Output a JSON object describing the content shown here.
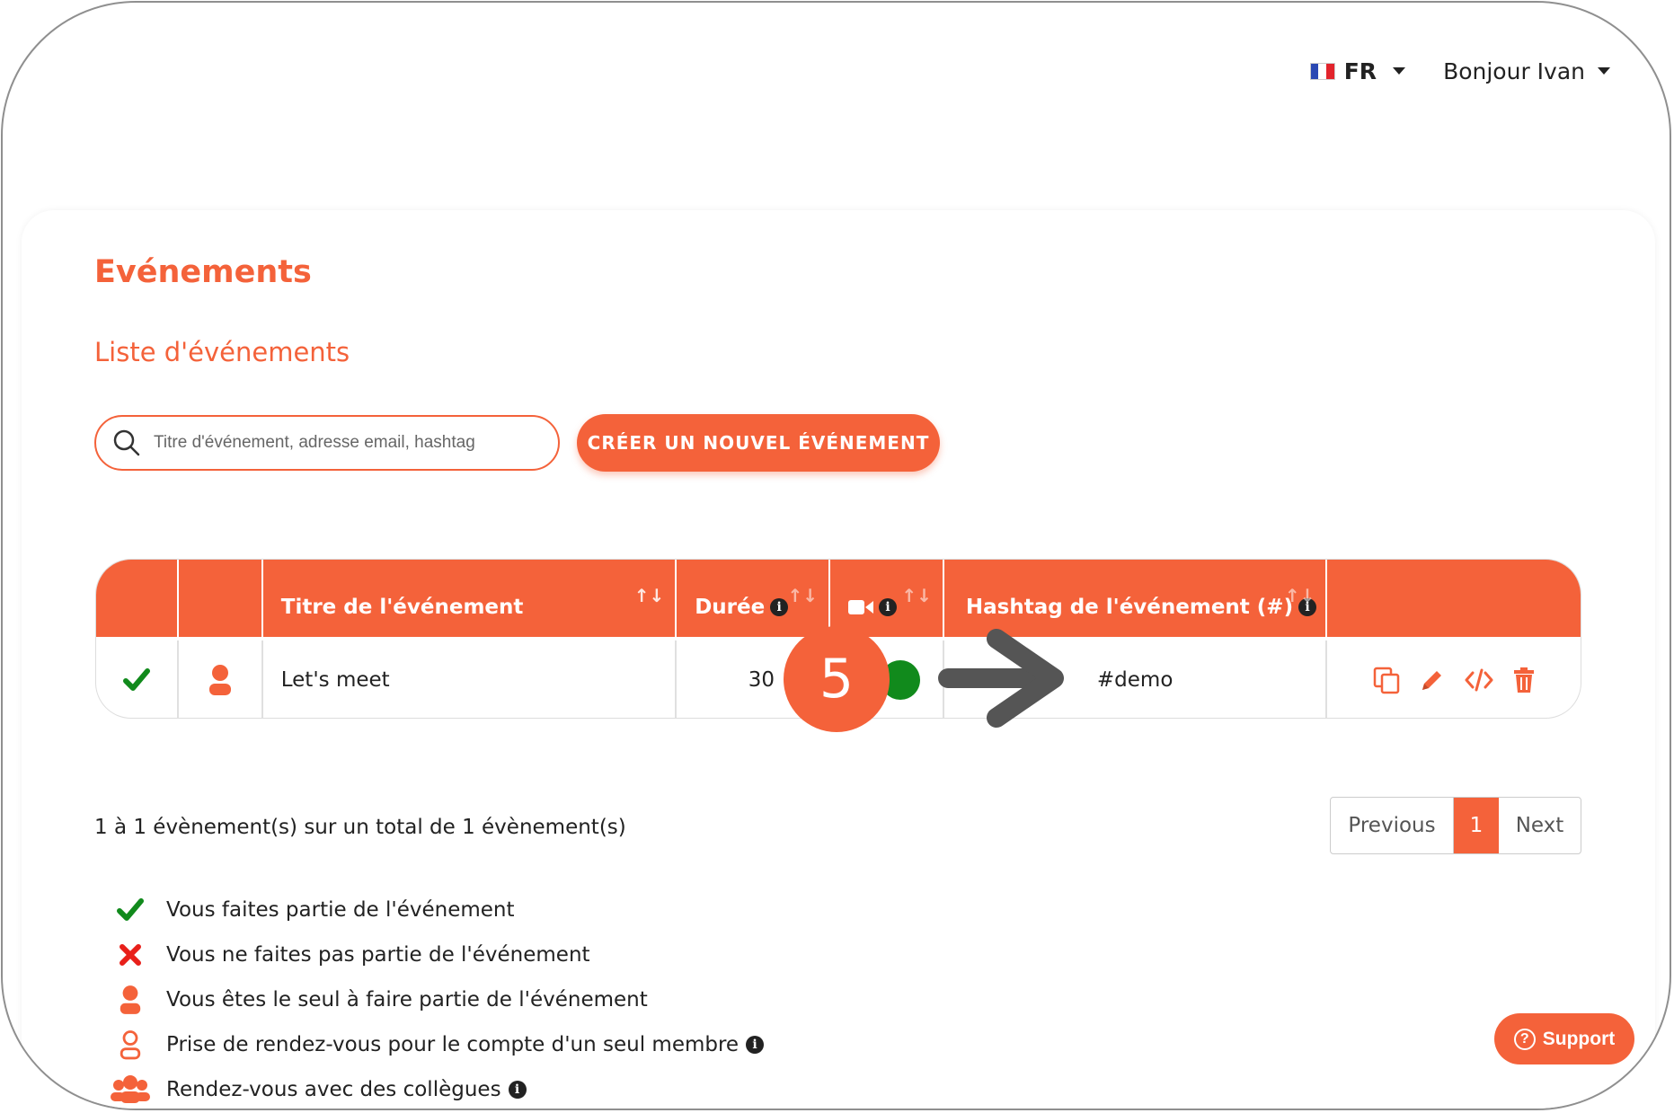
{
  "header": {
    "language": "FR",
    "greeting": "Bonjour Ivan"
  },
  "page": {
    "title": "Evénements",
    "subtitle": "Liste d'événements"
  },
  "search": {
    "placeholder": "Titre d'événement, adresse email, hashtag"
  },
  "create_button": "CRÉER UN NOUVEL ÉVÉNEMENT",
  "table": {
    "columns": {
      "title": "Titre de l'événement",
      "duration": "Durée",
      "hashtag": "Hashtag de l'événement (#)"
    },
    "rows": [
      {
        "title": "Let's meet",
        "duration": "30",
        "hashtag": "#demo",
        "video_enabled": true
      }
    ]
  },
  "annotation": {
    "step_number": "5"
  },
  "summary": "1 à 1 évènement(s) sur un total de 1 évènement(s)",
  "pagination": {
    "previous": "Previous",
    "current": "1",
    "next": "Next"
  },
  "legend": [
    {
      "icon": "check-icon",
      "label": "Vous faites partie de l'événement"
    },
    {
      "icon": "cross-icon",
      "label": "Vous ne faites pas partie de l'événement"
    },
    {
      "icon": "person-icon",
      "label": "Vous êtes le seul à faire partie de l'événement"
    },
    {
      "icon": "person-outline-icon",
      "label": "Prise de rendez-vous pour le compte d'un seul membre"
    },
    {
      "icon": "group-icon",
      "label": "Rendez-vous avec des collègues"
    }
  ],
  "support_label": "Support",
  "colors": {
    "accent": "#f4623a",
    "check_green": "#118a1c",
    "cross_red": "#e8201a"
  }
}
